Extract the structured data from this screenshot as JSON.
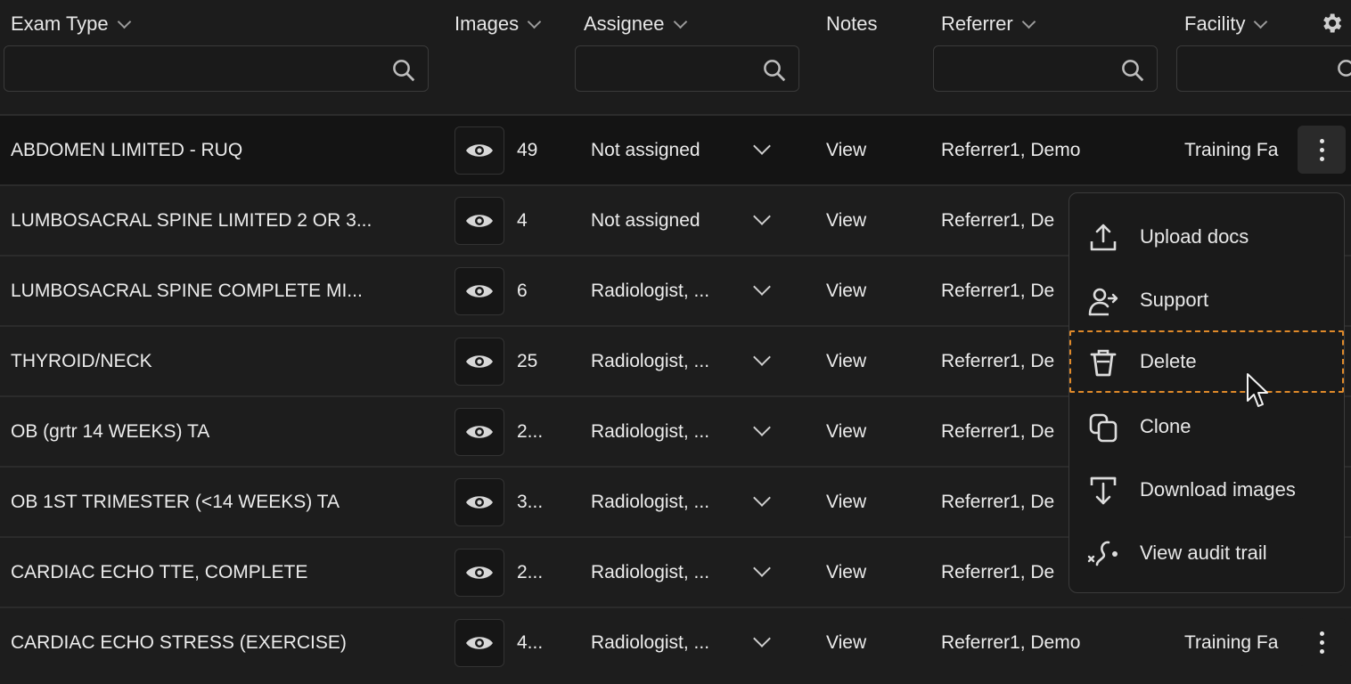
{
  "header": {
    "columns": {
      "exam_type": "Exam Type",
      "images": "Images",
      "assignee": "Assignee",
      "notes": "Notes",
      "referrer": "Referrer",
      "facility": "Facility"
    }
  },
  "rows": [
    {
      "exam": "ABDOMEN LIMITED - RUQ",
      "count": "49",
      "assignee": "Not assigned",
      "notes": "View",
      "referrer": "Referrer1, Demo",
      "facility": "Training Fa"
    },
    {
      "exam": "LUMBOSACRAL SPINE LIMITED 2 OR 3...",
      "count": "4",
      "assignee": "Not assigned",
      "notes": "View",
      "referrer": "Referrer1, De",
      "facility": ""
    },
    {
      "exam": "LUMBOSACRAL SPINE COMPLETE MI...",
      "count": "6",
      "assignee": "Radiologist, ...",
      "notes": "View",
      "referrer": "Referrer1, De",
      "facility": ""
    },
    {
      "exam": "THYROID/NECK",
      "count": "25",
      "assignee": "Radiologist, ...",
      "notes": "View",
      "referrer": "Referrer1, De",
      "facility": ""
    },
    {
      "exam": "OB (grtr 14 WEEKS) TA",
      "count": "2...",
      "assignee": "Radiologist, ...",
      "notes": "View",
      "referrer": "Referrer1, De",
      "facility": ""
    },
    {
      "exam": "OB 1ST TRIMESTER (<14 WEEKS) TA",
      "count": "3...",
      "assignee": "Radiologist, ...",
      "notes": "View",
      "referrer": "Referrer1, De",
      "facility": ""
    },
    {
      "exam": "CARDIAC ECHO TTE, COMPLETE",
      "count": "2...",
      "assignee": "Radiologist, ...",
      "notes": "View",
      "referrer": "Referrer1, De",
      "facility": ""
    },
    {
      "exam": "CARDIAC ECHO STRESS (EXERCISE)",
      "count": "4...",
      "assignee": "Radiologist, ...",
      "notes": "View",
      "referrer": "Referrer1, Demo",
      "facility": "Training Fa"
    }
  ],
  "menu": {
    "items": [
      {
        "label": "Upload docs",
        "icon": "upload-icon"
      },
      {
        "label": "Support",
        "icon": "support-icon"
      },
      {
        "label": "Delete",
        "icon": "trash-icon"
      },
      {
        "label": "Clone",
        "icon": "clone-icon"
      },
      {
        "label": "Download images",
        "icon": "download-icon"
      },
      {
        "label": "View audit trail",
        "icon": "audit-trail-icon"
      }
    ],
    "focused": "Delete"
  },
  "colors": {
    "background": "#1b1b1b",
    "text": "#e8e8e8",
    "focus_outline": "#e08a2a"
  }
}
